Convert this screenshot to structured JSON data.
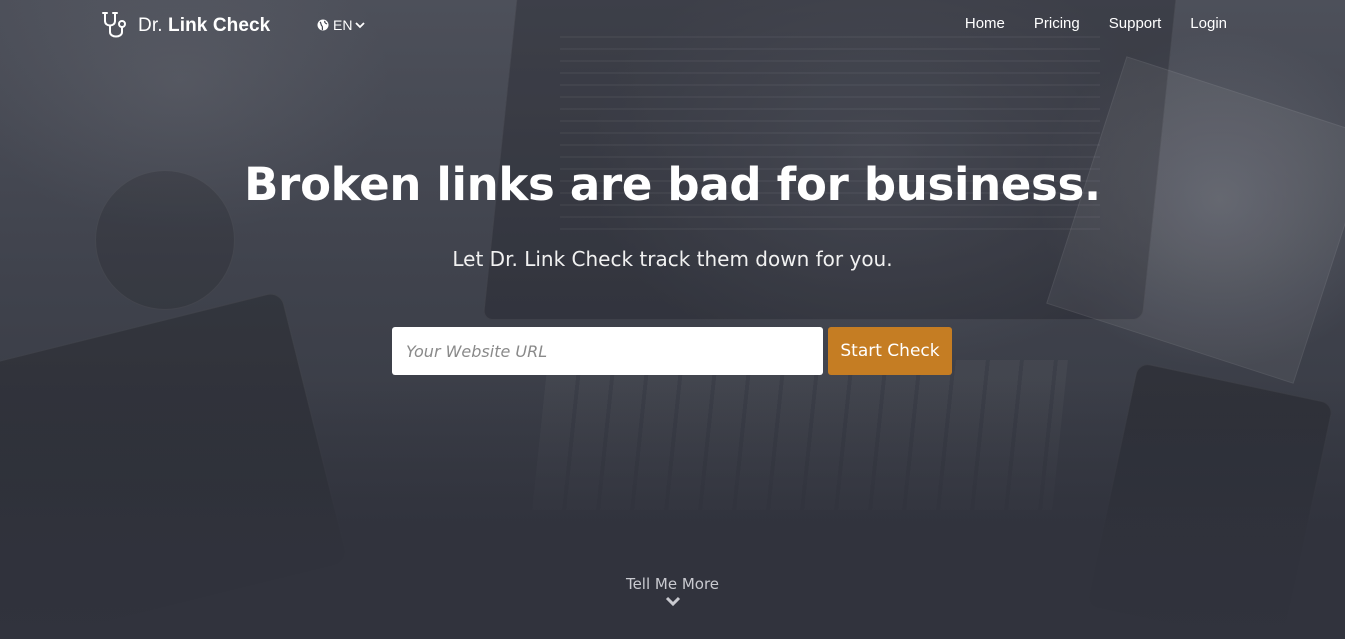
{
  "brand": {
    "prefix": "Dr.",
    "name": "Link Check",
    "icon": "stethoscope-icon"
  },
  "language": {
    "icon": "globe-icon",
    "code": "EN",
    "dropdown_icon": "chevron-down-icon"
  },
  "nav": {
    "items": [
      {
        "label": "Home"
      },
      {
        "label": "Pricing"
      },
      {
        "label": "Support"
      },
      {
        "label": "Login"
      }
    ]
  },
  "hero": {
    "headline": "Broken links are bad for business.",
    "subheadline": "Let Dr. Link Check track them down for you.",
    "url_input": {
      "placeholder": "Your Website URL",
      "value": ""
    },
    "start_button": "Start Check",
    "more_label": "Tell Me More",
    "more_icon": "chevron-down-icon"
  },
  "colors": {
    "accent": "#c57d23",
    "background": "#3a3d47",
    "text": "#ffffff"
  }
}
